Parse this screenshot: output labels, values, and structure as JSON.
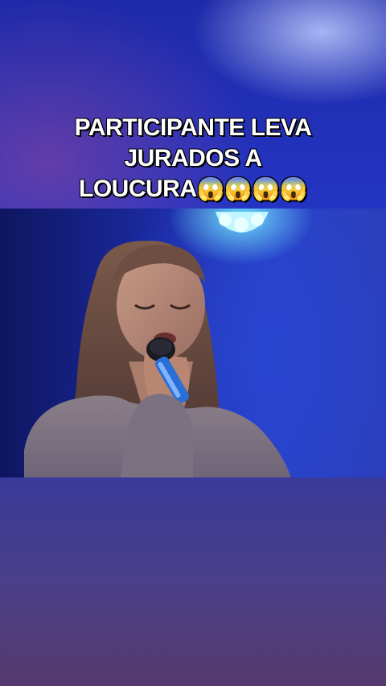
{
  "caption": {
    "line1": "PARTICIPANTE LEVA",
    "line2": "JURADOS  A",
    "line3": "LOUCURA",
    "emojis": "😱😱😱😱"
  },
  "video": {
    "subject": "woman-singing-into-microphone",
    "stage_light_color": "#7fe8ff",
    "background_color": "#1f2aa8"
  },
  "colors": {
    "caption_text": "#ffffff",
    "caption_outline": "#000000"
  }
}
